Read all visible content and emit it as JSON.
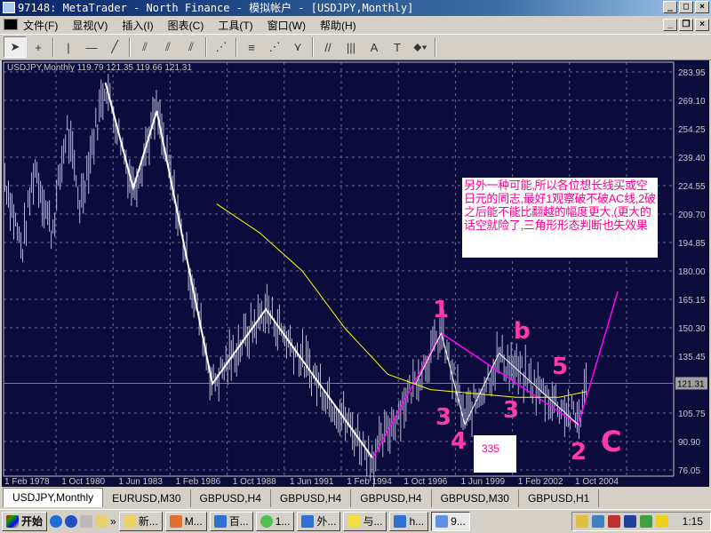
{
  "window": {
    "title": "97148: MetaTrader - North Finance - 模拟帐户 - [USDJPY,Monthly]"
  },
  "menu": [
    "文件(F)",
    "显视(V)",
    "插入(I)",
    "图表(C)",
    "工具(T)",
    "窗口(W)",
    "帮助(H)"
  ],
  "toolbar": [
    "cursor",
    "crosshair",
    "vertical-line",
    "horizontal-line",
    "trendline",
    "channel",
    "equidistant-channel",
    "std-dev-channel",
    "gann-fan",
    "fibonacci-retracement",
    "fibonacci-fan",
    "fibonacci-arcs",
    "parallel-lines",
    "cycle-lines",
    "text-label-A",
    "text-box",
    "arrows-dropdown"
  ],
  "chart": {
    "info": "USDJPY,Monthly  119.79 121.35 119.66 121.31",
    "current_price": "121.31",
    "note": "另外一种可能,所以各位想长线买或空日元的同志,最好1观察破不破AC线,2破之后能不能比翻越的幅度更大,(更大的话空就险了,三角形形态判断也失效果",
    "box_label": "335",
    "marks": {
      "m1": "1",
      "mb": "b",
      "m5": "5",
      "m3a": "3",
      "m3b": "3",
      "m4": "4",
      "m2": "2",
      "mc": "C"
    }
  },
  "chart_data": {
    "type": "line",
    "title": "USDJPY,Monthly",
    "ohlc_last": {
      "open": 119.79,
      "high": 121.35,
      "low": 119.66,
      "close": 121.31
    },
    "y_ticks": [
      "283.95",
      "269.10",
      "254.25",
      "239.40",
      "224.55",
      "209.70",
      "194.85",
      "180.00",
      "165.15",
      "150.30",
      "135.45",
      "121.31",
      "105.75",
      "90.90",
      "76.05"
    ],
    "ylim": [
      76.05,
      283.95
    ],
    "x_ticks": [
      "1 Feb 1978",
      "1 Oct 1980",
      "1 Jun 1983",
      "1 Feb 1986",
      "1 Oct 1988",
      "1 Jun 1991",
      "1 Feb 1994",
      "1 Oct 1996",
      "1 Jun 1999",
      "1 Feb 2002",
      "1 Oct 2004"
    ],
    "xlim": [
      1978.08,
      2007.2
    ],
    "series": [
      {
        "name": "white-zigzag",
        "color": "#ffffff",
        "points": [
          [
            1982.8,
            278.4
          ],
          [
            1984.1,
            223.2
          ],
          [
            1985.2,
            263.5
          ],
          [
            1987.8,
            121.1
          ],
          [
            1990.3,
            160.0
          ],
          [
            1995.3,
            82.1
          ]
        ]
      },
      {
        "name": "magenta-wave",
        "color": "#ff00ff",
        "points": [
          [
            1995.3,
            82.1
          ],
          [
            1998.5,
            147.5
          ],
          [
            2004.9,
            99.7
          ],
          [
            2006.75,
            169.3
          ]
        ]
      },
      {
        "name": "white-triangle",
        "color": "#ffffff",
        "points": [
          [
            1997.3,
            121
          ],
          [
            1998.5,
            147.5
          ],
          [
            1999.6,
            99.7
          ],
          [
            2001.2,
            137
          ],
          [
            2004.9,
            99.7
          ]
        ]
      },
      {
        "name": "moving-average",
        "color": "#ffff00",
        "points": [
          [
            1988,
            215
          ],
          [
            1990,
            200
          ],
          [
            1992,
            180
          ],
          [
            1994,
            150
          ],
          [
            1996,
            126
          ],
          [
            1998,
            118
          ],
          [
            2000,
            116
          ],
          [
            2002,
            114
          ],
          [
            2004,
            114
          ],
          [
            2005.3,
            117
          ]
        ]
      }
    ],
    "hline": 121.31
  },
  "tabs": [
    "USDJPY,Monthly",
    "EURUSD,M30",
    "GBPUSD,H4",
    "GBPUSD,H4",
    "GBPUSD,H4",
    "GBPUSD,M30",
    "GBPUSD,H1"
  ],
  "taskbar": {
    "start": "开始",
    "tasks": [
      "新...",
      "M...",
      "百...",
      "1...",
      "外...",
      "与...",
      "h...",
      "9..."
    ],
    "clock": "1:15"
  }
}
